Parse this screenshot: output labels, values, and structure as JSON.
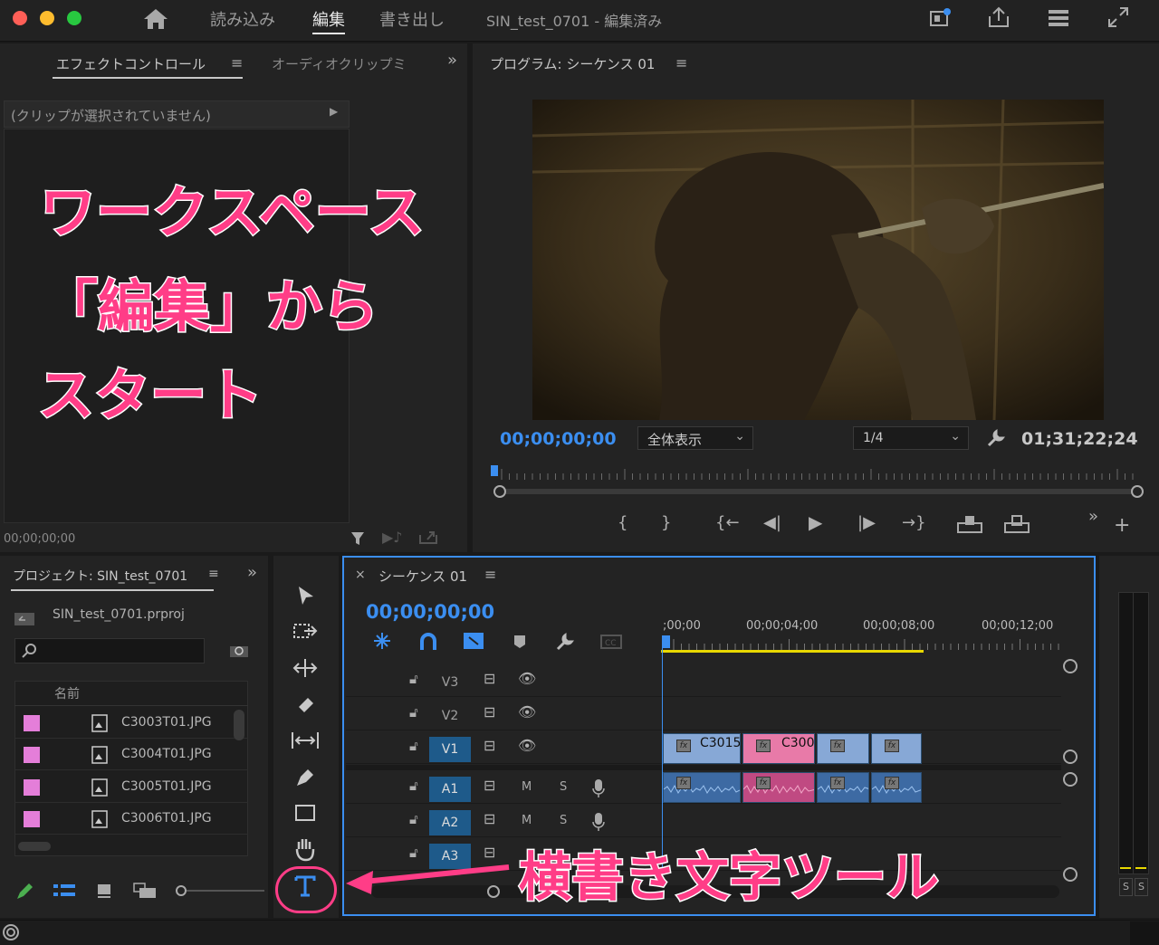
{
  "topbar": {
    "tabs": [
      "読み込み",
      "編集",
      "書き出し"
    ],
    "active_tab": "編集",
    "project_title": "SIN_test_0701 - 編集済み"
  },
  "effect_panel": {
    "tab_effect": "エフェクトコントロール",
    "tab_audio": "オーディオクリップミ",
    "no_clip": "(クリップが選択されていません)",
    "timecode": "00;00;00;00"
  },
  "program": {
    "title": "プログラム: シーケンス 01",
    "timecode": "00;00;00;00",
    "fit": "全体表示",
    "resolution": "1/4",
    "duration": "01;31;22;24"
  },
  "project": {
    "title": "プロジェクト: SIN_test_0701",
    "file": "SIN_test_0701.prproj",
    "col_name": "名前",
    "items": [
      "C3003T01.JPG",
      "C3004T01.JPG",
      "C3005T01.JPG",
      "C3006T01.JPG"
    ]
  },
  "timeline": {
    "title": "シーケンス 01",
    "timecode": "00;00;00;00",
    "ruler": [
      ";00;00",
      "00;00;04;00",
      "00;00;08;00",
      "00;00;12;00"
    ],
    "tracks_video": [
      "V3",
      "V2",
      "V1"
    ],
    "tracks_audio": [
      "A1",
      "A2",
      "A3"
    ],
    "clip_labels": [
      "C3015",
      "C300"
    ],
    "m": "M",
    "s": "S"
  },
  "meter": {
    "s1": "S",
    "s2": "S"
  },
  "annotations": {
    "line1": "ワークスペース",
    "line2": "「編集」から",
    "line3": "スタート",
    "tool": "横書き文字ツール"
  },
  "colors": {
    "accent_blue": "#3b8ef0",
    "clip_pink": "#e87aa8",
    "clip_blue": "#87a8d6",
    "annotation": "#ff3d87"
  }
}
